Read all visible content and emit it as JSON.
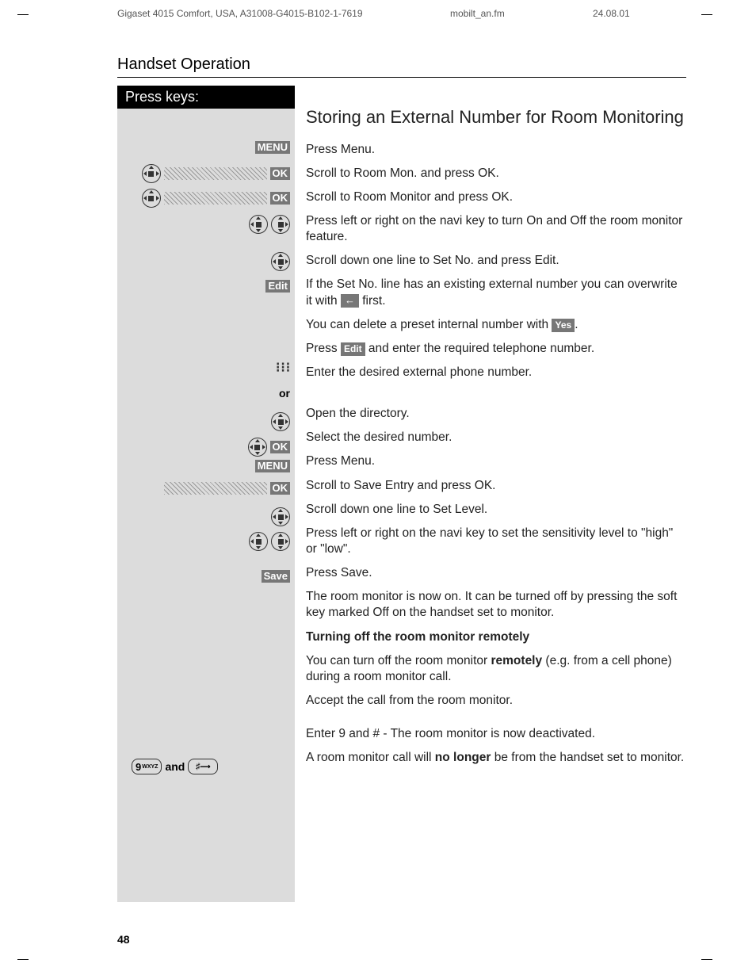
{
  "meta": {
    "doc_id": "Gigaset 4015 Comfort, USA, A31008-G4015-B102-1-7619",
    "file_name": "mobilt_an.fm",
    "date": "24.08.01"
  },
  "section_title": "Handset Operation",
  "left": {
    "press_keys": "Press keys:",
    "menu": "MENU",
    "ok": "OK",
    "edit": "Edit",
    "save": "Save",
    "or": "or",
    "and": "and",
    "nine_key": "9",
    "nine_key_letters": "WXYZ",
    "hash_key": "♯"
  },
  "right": {
    "heading": "Storing an External Number for Room Monitoring",
    "p1": "Press Menu.",
    "p2": "Scroll to Room Mon. and press OK.",
    "p3": "Scroll to Room Monitor and press OK.",
    "p4": "Press left or right on the navi key to turn On and Off the room monitor feature.",
    "p5": "Scroll down one line to Set No. and press Edit.",
    "p6a": "If the Set No. line has an existing external number you can overwrite it with ",
    "p6b": " first.",
    "p7a": "You can delete a preset internal number with ",
    "p7yes": "Yes",
    "p7b": ".",
    "p8a": "Press ",
    "p8edit": "Edit",
    "p8b": " and enter the required telephone number.",
    "p9": "Enter the desired external phone number.",
    "p10": "Open the directory.",
    "p11": "Select the desired number.",
    "p12": "Press Menu.",
    "p13": "Scroll to Save Entry and press OK.",
    "p14": "Scroll down one line to Set Level.",
    "p15": "Press left or right on the navi key to set the sensitivity level to \"high\" or \"low\".",
    "p16": "Press Save.",
    "p17": "The room monitor is now on.  It can be turned off by pressing the soft key marked Off on the handset set to monitor.",
    "sub1": "Turning off the room monitor remotely",
    "p18a": "You can turn off the room monitor ",
    "p18bold": "remotely",
    "p18b": " (e.g. from a cell phone) during a room monitor call.",
    "p19": "Accept the call from the room monitor.",
    "p20": "Enter 9 and # - The room monitor is now deactivated.",
    "p21a": "A room monitor call will ",
    "p21bold": "no longer",
    "p21b": " be from the handset set to monitor."
  },
  "page_number": "48"
}
